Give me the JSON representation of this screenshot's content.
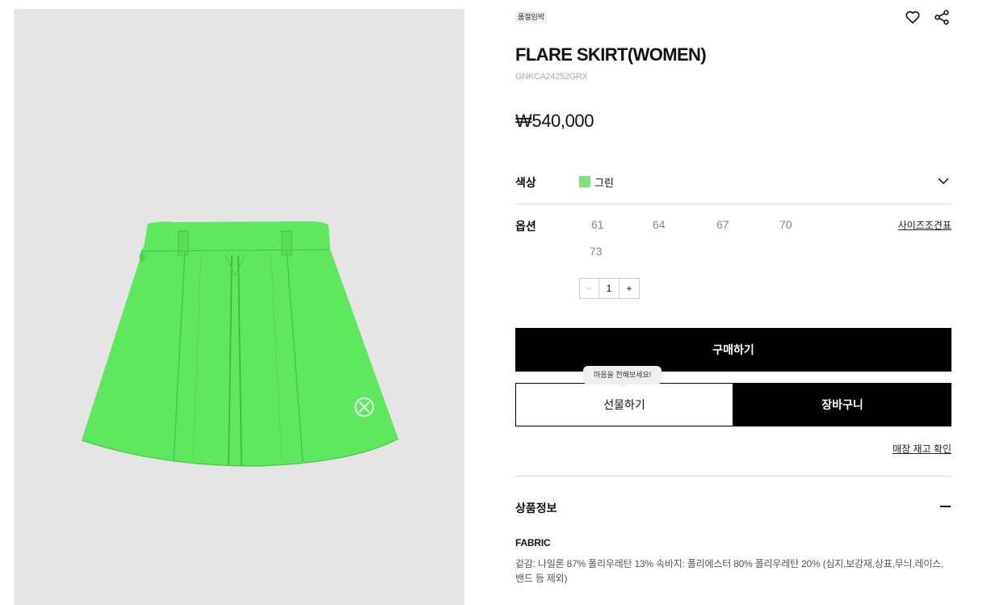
{
  "product": {
    "badge": "품절임박",
    "title": "FLARE SKIRT(WOMEN)",
    "code": "GNKCA24252GRX",
    "price": "₩540,000"
  },
  "color": {
    "label": "색상",
    "value": "그린",
    "swatch": "#7ee37e"
  },
  "option": {
    "label": "옵션",
    "sizes": [
      "61",
      "64",
      "67",
      "70",
      "73"
    ],
    "size_guide": "사이즈조견표"
  },
  "quantity": {
    "minus": "−",
    "value": "1",
    "plus": "+"
  },
  "actions": {
    "buy": "구매하기",
    "gift": "선물하기",
    "gift_tooltip": "마음을 전해보세요!",
    "cart": "장바구니",
    "store_stock": "매장 재고 확인"
  },
  "info": {
    "section_title": "상품정보",
    "fabric_heading": "FABRIC",
    "fabric_text": "겉감: 나일론 87% 폴리우레탄 13% 속바지: 폴리에스터 80% 폴리우레탄 20% (심지,보강재,상표,무늬,레이스,밴드 등 제외)"
  },
  "icons": {
    "like": "heart-icon",
    "share": "share-icon",
    "dropdown": "chevron-down-icon",
    "collapse": "minus-icon"
  },
  "colors": {
    "image_bg": "#e5e5e5",
    "skirt": "#5fe85f",
    "primary_button": "#000000"
  }
}
